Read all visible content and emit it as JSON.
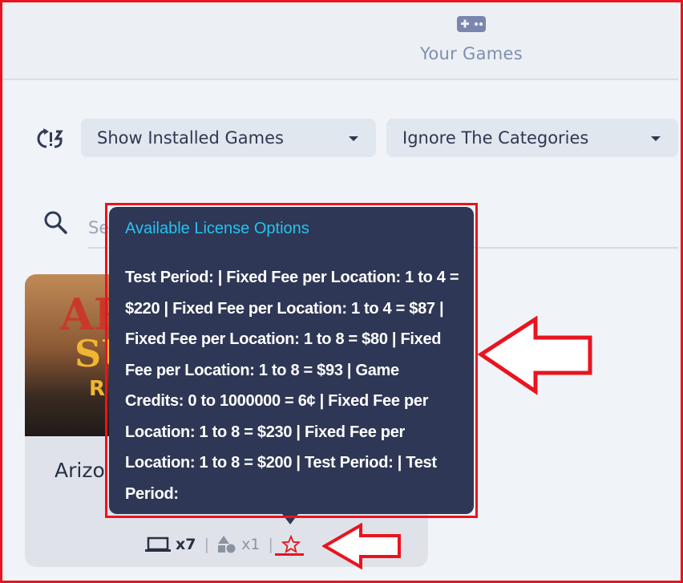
{
  "tabs": [
    {
      "label": "Your Games",
      "icon": "gamepad-icon"
    }
  ],
  "filters": {
    "refresh_icon": "refresh-icon",
    "installed_dropdown": "Show Installed Games",
    "categories_dropdown": "Ignore The Categories"
  },
  "search": {
    "placeholder": "Se"
  },
  "game_card": {
    "title": "Arizo",
    "art_text": {
      "line1": "AR",
      "line2": "SU",
      "line3": "R"
    },
    "locations_count": "x7",
    "types_count": "x1",
    "license_icon": "star-outline-icon"
  },
  "tooltip": {
    "title": "Available License Options",
    "text": "Test Period: | Fixed Fee per Location: 1 to 4 = $220 | Fixed Fee per Location: 1 to 4 = $87 | Fixed Fee per Location: 1 to 8 = $80 | Fixed Fee per Location: 1 to 8 = $93 | Game Credits: 0 to 1000000 = 6¢ | Fixed Fee per Location: 1 to 8 = $230 | Fixed Fee per Location: 1 to 8 = $200 | Test Period: | Test Period:"
  },
  "colors": {
    "annotation": "#e8141f",
    "tooltip_bg": "#2e3755",
    "tooltip_title": "#26c3ee",
    "tab_label": "#7e8fb0"
  }
}
